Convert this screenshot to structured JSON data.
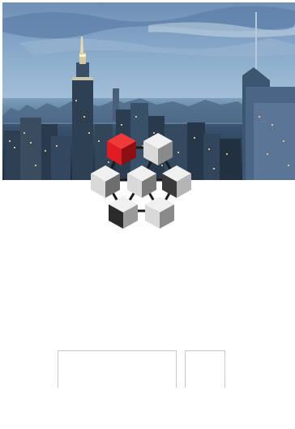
{
  "hero": {
    "image": "city-skyline-dusk"
  },
  "logo": {
    "image": "cube-cluster-logo",
    "accent_color": "#e01b24",
    "cube_color": "#d9d9d9"
  },
  "form": {
    "main_field": {
      "value": "",
      "placeholder": ""
    },
    "side_field": {
      "value": "",
      "placeholder": ""
    }
  }
}
